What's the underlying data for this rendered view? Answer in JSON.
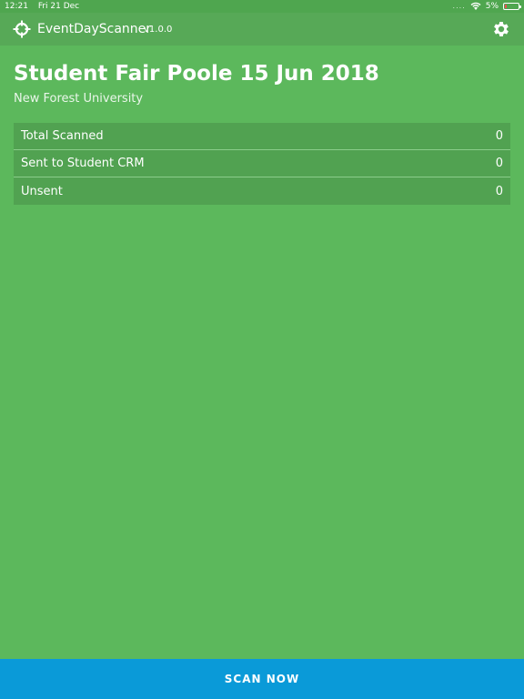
{
  "status_bar": {
    "time": "12:21",
    "date": "Fri 21 Dec",
    "signal": "....",
    "battery_percent": "5%",
    "battery_level": 0.05
  },
  "header": {
    "app_name": "EventDayScanner",
    "version": "v1.0.0",
    "logo_icon": "crosshair-icon",
    "settings_icon": "gear-icon"
  },
  "event": {
    "title": "Student Fair Poole 15 Jun 2018",
    "organization": "New Forest University"
  },
  "stats": [
    {
      "label": "Total Scanned",
      "value": "0"
    },
    {
      "label": "Sent to Student CRM",
      "value": "0"
    },
    {
      "label": "Unsent",
      "value": "0"
    }
  ],
  "actions": {
    "scan_label": "SCAN NOW"
  },
  "colors": {
    "background": "#5cb85c",
    "header": "#57a957",
    "row": "#51a251",
    "scan_button": "#0a9ad8"
  }
}
